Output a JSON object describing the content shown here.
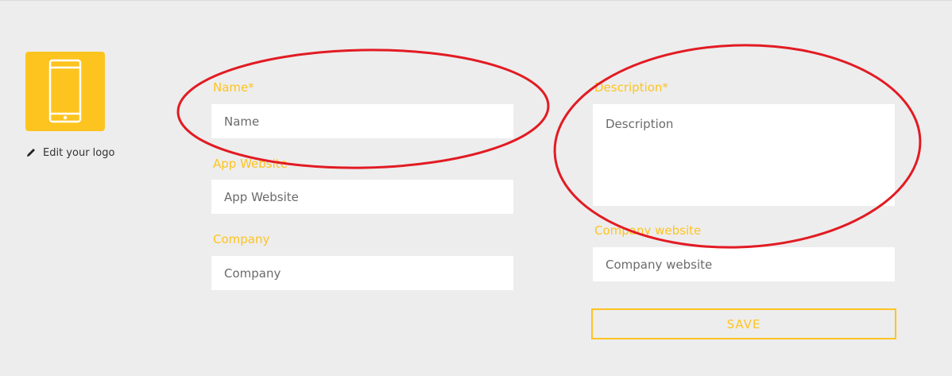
{
  "logo": {
    "icon": "smartphone-icon",
    "edit_icon": "pencil-icon",
    "edit_label": "Edit your logo",
    "bg_color": "#fdc420"
  },
  "form": {
    "name": {
      "label": "Name*",
      "placeholder": "Name"
    },
    "app_website": {
      "label": "App Website",
      "placeholder": "App Website"
    },
    "company": {
      "label": "Company",
      "placeholder": "Company"
    },
    "description": {
      "label": "Description*",
      "placeholder": "Description"
    },
    "company_website": {
      "label": "Company website",
      "placeholder": "Company website"
    },
    "save_label": "SAVE"
  },
  "colors": {
    "accent": "#fdc420",
    "background": "#ededed",
    "annotation": "#e21b23"
  }
}
